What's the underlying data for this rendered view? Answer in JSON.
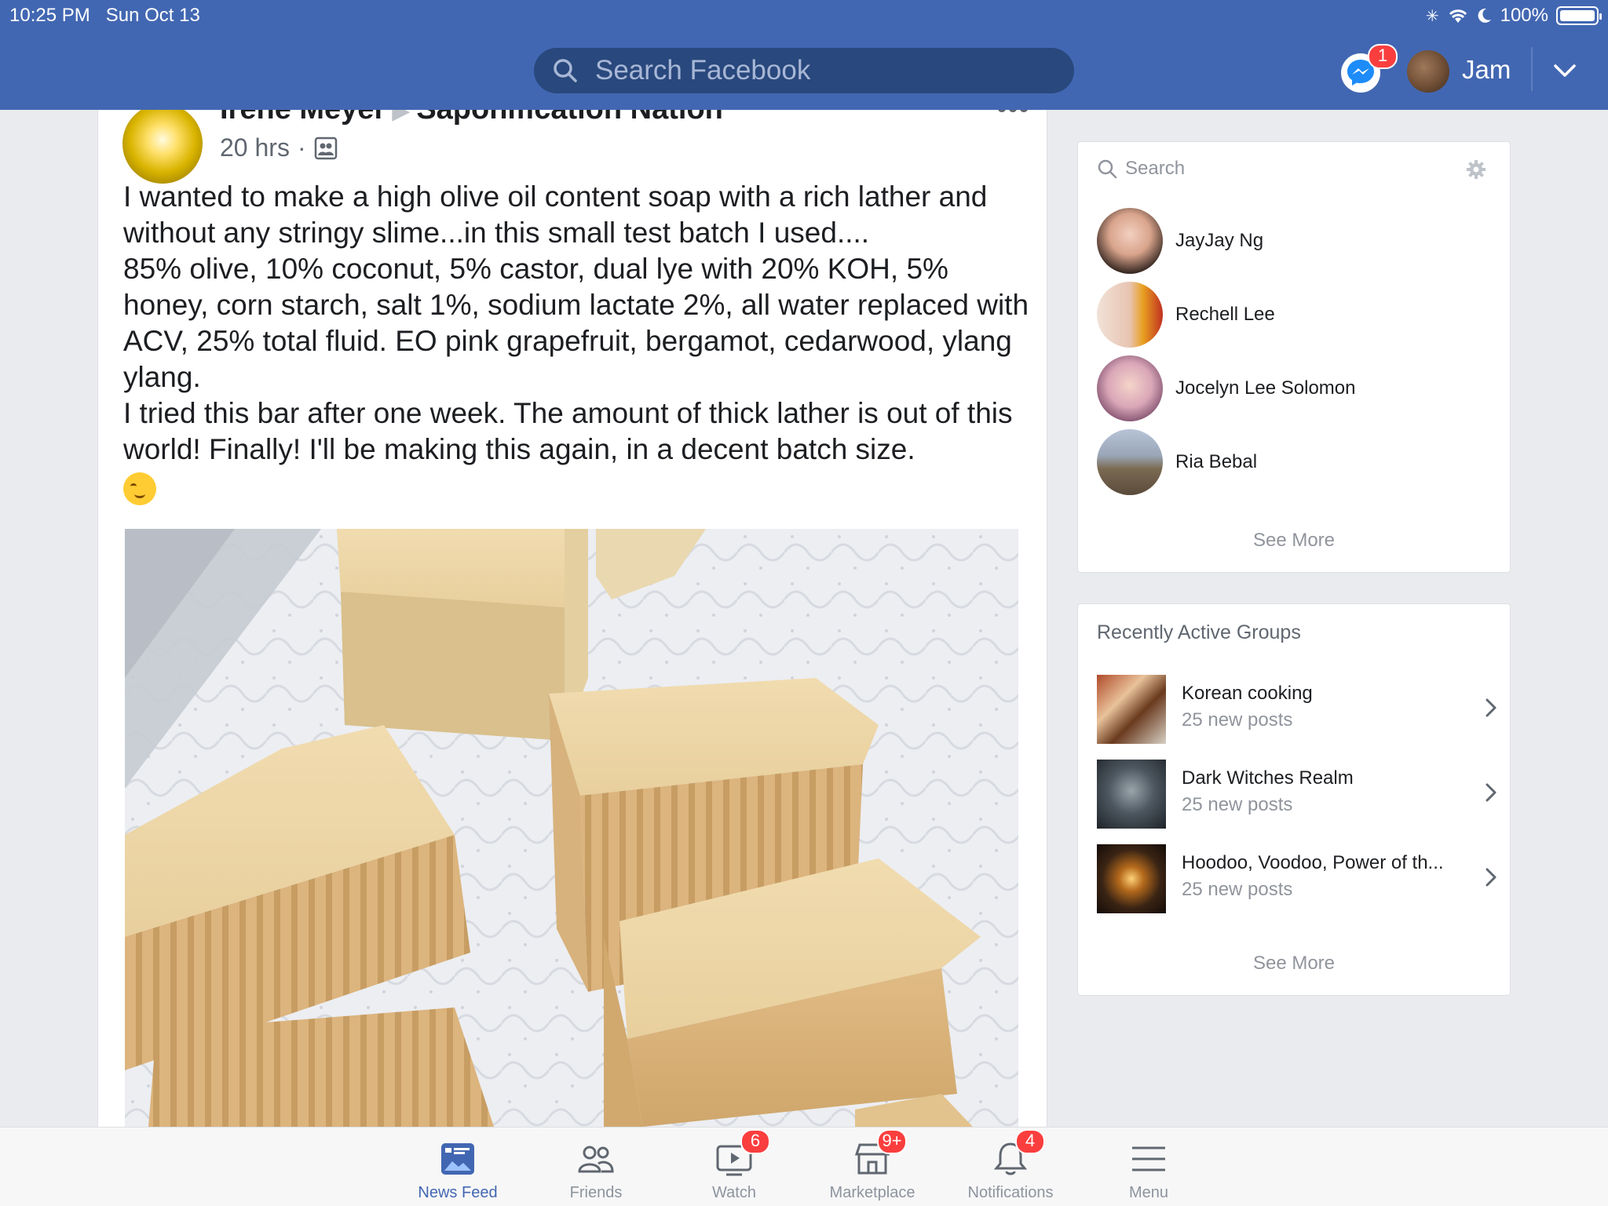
{
  "status": {
    "time": "10:25 PM",
    "date": "Sun Oct 13",
    "battery": "100%"
  },
  "header": {
    "search_placeholder": "Search Facebook",
    "messenger_badge": "1",
    "user_name": "Jam",
    "brand_color": "#4267b2"
  },
  "post": {
    "author": "Irene Meyer",
    "group": "Saponification Nation",
    "time": "20 hrs",
    "separator": "·",
    "text_lines": [
      "I wanted to make a high olive oil content soap with a rich lather and without any stringy slime...in this small test batch I used....",
      "85% olive, 10% coconut, 5% castor, dual lye with 20% KOH, 5% honey, corn starch, salt 1%, sodium lactate 2%, all water replaced with ACV, 25% total fluid. EO pink grapefruit, bergamot, cedarwood, ylang ylang.",
      "I tried this bar after one week. The amount of thick lather is out of this world! Finally! I'll be making this again, in a decent batch size."
    ],
    "more_icon": "more-options-icon",
    "photo_icon": "soap-bars-photo"
  },
  "contacts": {
    "search_placeholder": "Search",
    "items": [
      {
        "name": "JayJay Ng"
      },
      {
        "name": "Rechell Lee"
      },
      {
        "name": "Jocelyn Lee Solomon"
      },
      {
        "name": "Ria Bebal"
      }
    ],
    "see_more": "See More"
  },
  "groups": {
    "title": "Recently Active Groups",
    "items": [
      {
        "name": "Korean cooking",
        "sub": "25 new posts"
      },
      {
        "name": "Dark Witches Realm",
        "sub": "25 new posts"
      },
      {
        "name": "Hoodoo, Voodoo, Power of th...",
        "sub": "25 new posts"
      }
    ],
    "see_more": "See More"
  },
  "tabbar": {
    "tabs": [
      {
        "label": "News Feed",
        "badge": ""
      },
      {
        "label": "Friends",
        "badge": ""
      },
      {
        "label": "Watch",
        "badge": "6"
      },
      {
        "label": "Marketplace",
        "badge": "9+"
      },
      {
        "label": "Notifications",
        "badge": "4"
      },
      {
        "label": "Menu",
        "badge": ""
      }
    ],
    "active": "News Feed"
  }
}
